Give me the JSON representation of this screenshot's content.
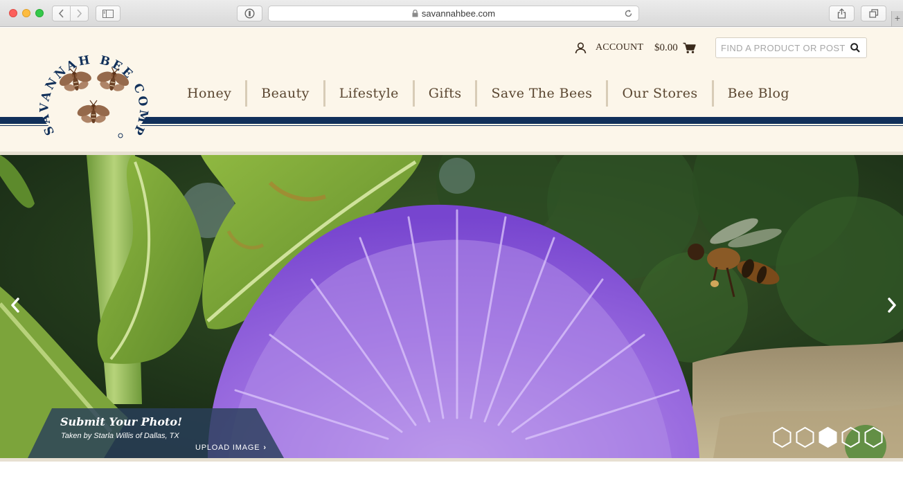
{
  "browser": {
    "url": "savannahbee.com",
    "icons": [
      "back-icon",
      "forward-icon",
      "sidebar-icon",
      "reader-icon",
      "lock-icon",
      "reload-icon",
      "share-icon",
      "tabs-icon",
      "new-tab-icon"
    ]
  },
  "header": {
    "logo_text": "SAVANNAH BEE COMPANY",
    "account_label": "ACCOUNT",
    "cart_total": "$0.00",
    "search_placeholder": "FIND A PRODUCT OR POST",
    "nav": [
      "Honey",
      "Beauty",
      "Lifestyle",
      "Gifts",
      "Save The Bees",
      "Our Stores",
      "Bee Blog"
    ],
    "colors": {
      "cream": "#fcf6ea",
      "navy": "#11305a",
      "brown": "#5a4630"
    }
  },
  "hero": {
    "caption_title": "Submit Your Photo!",
    "caption_credit": "Taken by Starla Willis of Dallas, TX",
    "upload_label": "UPLOAD IMAGE",
    "slides": 5,
    "active_slide": 3
  }
}
